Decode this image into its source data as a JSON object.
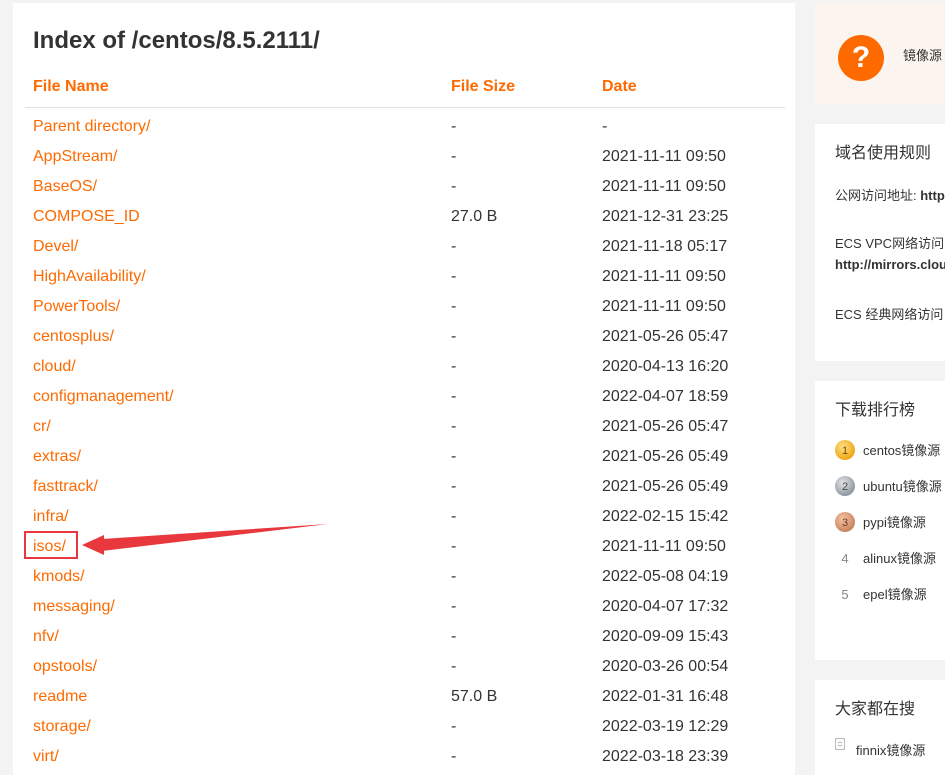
{
  "page_title": "Index of /centos/8.5.2111/",
  "table_headers": {
    "name": "File Name",
    "size": "File Size",
    "date": "Date"
  },
  "rows": [
    {
      "name": "Parent directory/",
      "size": "-",
      "date": "-"
    },
    {
      "name": "AppStream/",
      "size": "-",
      "date": "2021-11-11 09:50"
    },
    {
      "name": "BaseOS/",
      "size": "-",
      "date": "2021-11-11 09:50"
    },
    {
      "name": "COMPOSE_ID",
      "size": "27.0 B",
      "date": "2021-12-31 23:25"
    },
    {
      "name": "Devel/",
      "size": "-",
      "date": "2021-11-18 05:17"
    },
    {
      "name": "HighAvailability/",
      "size": "-",
      "date": "2021-11-11 09:50"
    },
    {
      "name": "PowerTools/",
      "size": "-",
      "date": "2021-11-11 09:50"
    },
    {
      "name": "centosplus/",
      "size": "-",
      "date": "2021-05-26 05:47"
    },
    {
      "name": "cloud/",
      "size": "-",
      "date": "2020-04-13 16:20"
    },
    {
      "name": "configmanagement/",
      "size": "-",
      "date": "2022-04-07 18:59"
    },
    {
      "name": "cr/",
      "size": "-",
      "date": "2021-05-26 05:47"
    },
    {
      "name": "extras/",
      "size": "-",
      "date": "2021-05-26 05:49"
    },
    {
      "name": "fasttrack/",
      "size": "-",
      "date": "2021-05-26 05:49"
    },
    {
      "name": "infra/",
      "size": "-",
      "date": "2022-02-15 15:42"
    },
    {
      "name": "isos/",
      "size": "-",
      "date": "2021-11-11 09:50"
    },
    {
      "name": "kmods/",
      "size": "-",
      "date": "2022-05-08 04:19"
    },
    {
      "name": "messaging/",
      "size": "-",
      "date": "2020-04-07 17:32"
    },
    {
      "name": "nfv/",
      "size": "-",
      "date": "2020-09-09 15:43"
    },
    {
      "name": "opstools/",
      "size": "-",
      "date": "2020-03-26 00:54"
    },
    {
      "name": "readme",
      "size": "57.0 B",
      "date": "2022-01-31 16:48"
    },
    {
      "name": "storage/",
      "size": "-",
      "date": "2022-03-19 12:29"
    },
    {
      "name": "virt/",
      "size": "-",
      "date": "2022-03-18 23:39"
    }
  ],
  "sidebar": {
    "help": {
      "icon": "question-icon",
      "glyph": "?",
      "text": "镜像源"
    },
    "domain_rules": {
      "title": "域名使用规则",
      "public_label": "公网访问地址: ",
      "public_value": "http",
      "vpc_label": "ECS VPC网络访问",
      "vpc_value": "http://mirrors.clou",
      "classic_label": "ECS 经典网络访问"
    },
    "ranking": {
      "title": "下载排行榜",
      "items": [
        {
          "rank": "1",
          "label": "centos镜像源",
          "badge": "gold"
        },
        {
          "rank": "2",
          "label": "ubuntu镜像源",
          "badge": "silver"
        },
        {
          "rank": "3",
          "label": "pypi镜像源",
          "badge": "bronze"
        },
        {
          "rank": "4",
          "label": "alinux镜像源",
          "badge": ""
        },
        {
          "rank": "5",
          "label": "epel镜像源",
          "badge": ""
        }
      ]
    },
    "popular": {
      "title": "大家都在搜",
      "items": [
        {
          "label": "finnix镜像源",
          "icon": "document-icon"
        }
      ]
    }
  },
  "colors": {
    "accent": "#ff6a00",
    "annotation": "#e8383d"
  }
}
